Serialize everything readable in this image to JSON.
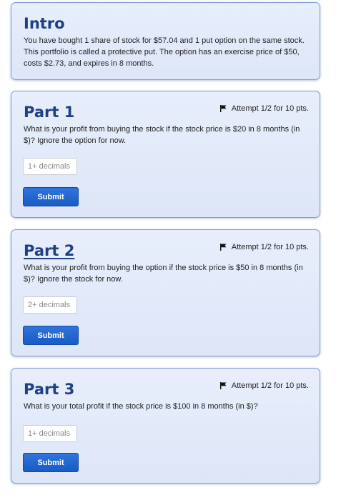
{
  "intro": {
    "title": "Intro",
    "text": "You have bought 1 share of stock for $57.04 and 1 put option on the same stock. This portfolio is called a protective put. The option has an exercise price of $50, costs $2.73, and expires in 8 months."
  },
  "parts": [
    {
      "title": "Part 1",
      "attempt": "Attempt 1/2 for 10 pts.",
      "question": "What is your profit from buying the stock if the stock price is $20 in 8 months (in $)? Ignore the option for now.",
      "placeholder": "1+ decimals",
      "submit_label": "Submit"
    },
    {
      "title": "Part 2",
      "attempt": "Attempt 1/2 for 10 pts.",
      "question": "What is your profit from buying the option if the stock price is $50 in 8 months (in $)? Ignore the stock for now.",
      "placeholder": "2+ decimals",
      "submit_label": "Submit"
    },
    {
      "title": "Part 3",
      "attempt": "Attempt 1/2 for 10 pts.",
      "question": "What is your total profit if the stock price is $100 in 8 months (in $)?",
      "placeholder": "1+ decimals",
      "submit_label": "Submit"
    }
  ],
  "icons": {
    "attempt": "flag-icon"
  },
  "colors": {
    "title": "#1f3f86",
    "card_border": "#7f9fd0",
    "button": "#1a5bc4"
  }
}
